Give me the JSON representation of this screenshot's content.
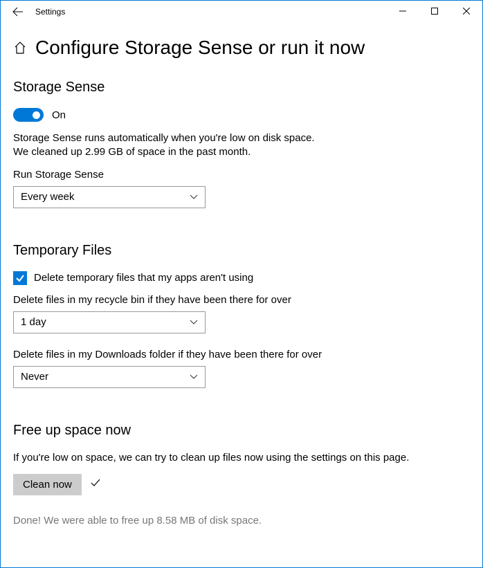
{
  "window": {
    "title": "Settings"
  },
  "page": {
    "title": "Configure Storage Sense or run it now"
  },
  "storage_sense": {
    "section_title": "Storage Sense",
    "toggle_state": "On",
    "description": "Storage Sense runs automatically when you're low on disk space.\nWe cleaned up 2.99 GB of space in the past month.",
    "run_label": "Run Storage Sense",
    "run_value": "Every week"
  },
  "temporary_files": {
    "section_title": "Temporary Files",
    "checkbox_label": "Delete temporary files that my apps aren't using",
    "recycle_label": "Delete files in my recycle bin if they have been there for over",
    "recycle_value": "1 day",
    "downloads_label": "Delete files in my Downloads folder if they have been there for over",
    "downloads_value": "Never"
  },
  "free_up": {
    "section_title": "Free up space now",
    "description": "If you're low on space, we can try to clean up files now using the settings on this page.",
    "button_label": "Clean now",
    "done_text": "Done! We were able to free up 8.58 MB of disk space."
  }
}
